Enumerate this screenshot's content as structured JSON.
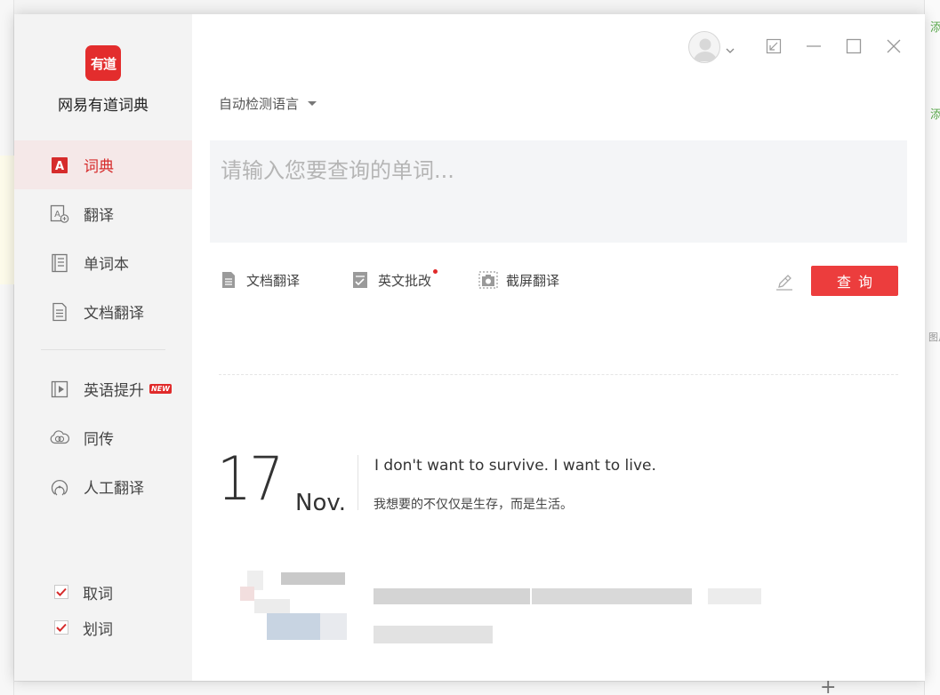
{
  "app": {
    "logo_text": "有道",
    "name": "网易有道词典"
  },
  "sidebar": {
    "items": [
      {
        "label": "词典",
        "icon": "dictionary-icon"
      },
      {
        "label": "翻译",
        "icon": "translate-icon"
      },
      {
        "label": "单词本",
        "icon": "wordbook-icon"
      },
      {
        "label": "文档翻译",
        "icon": "document-icon"
      }
    ],
    "items2": [
      {
        "label": "英语提升",
        "icon": "video-icon",
        "badge": "NEW"
      },
      {
        "label": "同传",
        "icon": "simultaneous-icon"
      },
      {
        "label": "人工翻译",
        "icon": "human-translate-icon"
      }
    ],
    "options": [
      {
        "label": "取词",
        "checked": true
      },
      {
        "label": "划词",
        "checked": true
      }
    ]
  },
  "toolbar": {
    "lang_select": "自动检测语言",
    "query_placeholder": "请输入您要查询的单词...",
    "doc_translate": "文档翻译",
    "essay_correct": "英文批改",
    "screenshot_translate": "截屏翻译",
    "search_button": "查询"
  },
  "daily": {
    "day": "17",
    "month": "Nov.",
    "quote_en": "I don't want to survive. I want to live.",
    "quote_zh": "我想要的不仅仅是生存，而是生活。"
  },
  "background": {
    "right_text_1": "添加",
    "right_text_2": "添加",
    "right_text_3": "图片"
  },
  "colors": {
    "accent": "#ec3d3d",
    "sidebar_bg": "#f3f3f3",
    "active_bg": "#f5e8e8"
  }
}
